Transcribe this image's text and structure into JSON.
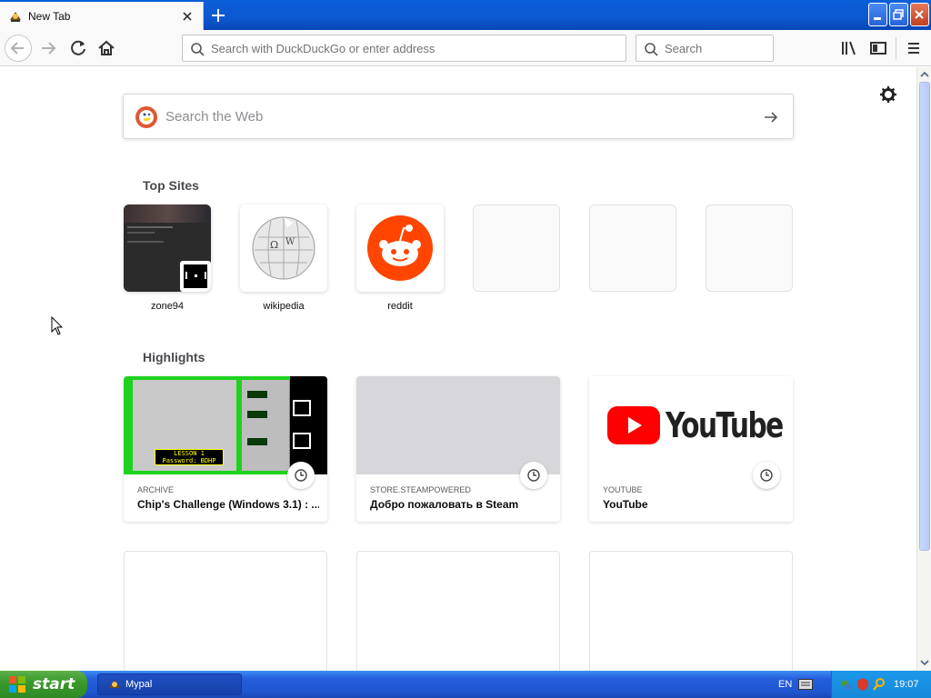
{
  "browser": {
    "tab": {
      "title": "New Tab"
    },
    "urlbar": {
      "placeholder": "Search with DuckDuckGo or enter address"
    },
    "searchbar": {
      "placeholder": "Search"
    }
  },
  "newtab": {
    "web_search": {
      "placeholder": "Search the Web"
    },
    "top_sites_title": "Top Sites",
    "top_sites": [
      {
        "label": "zone94"
      },
      {
        "label": "wikipedia"
      },
      {
        "label": "reddit"
      },
      {
        "label": ""
      },
      {
        "label": ""
      },
      {
        "label": ""
      }
    ],
    "highlights_title": "Highlights",
    "highlights": [
      {
        "source": "ARCHIVE",
        "title": "Chip's Challenge (Windows 3.1) : ...",
        "image_caption": "LESSON 1 Password: BDHP"
      },
      {
        "source": "STORE.STEAMPOWERED",
        "title": "Добро пожаловать в Steam"
      },
      {
        "source": "YOUTUBE",
        "title": "YouTube",
        "image_caption": "YouTube"
      }
    ]
  },
  "taskbar": {
    "start_label": "start",
    "task_label": "Mypal",
    "language": "EN",
    "time": "19:07"
  },
  "colors": {
    "reddit": "#ff4500",
    "youtube_red": "#ff0000",
    "xp_blue": "#245edb",
    "xp_green": "#3a9a2d"
  }
}
